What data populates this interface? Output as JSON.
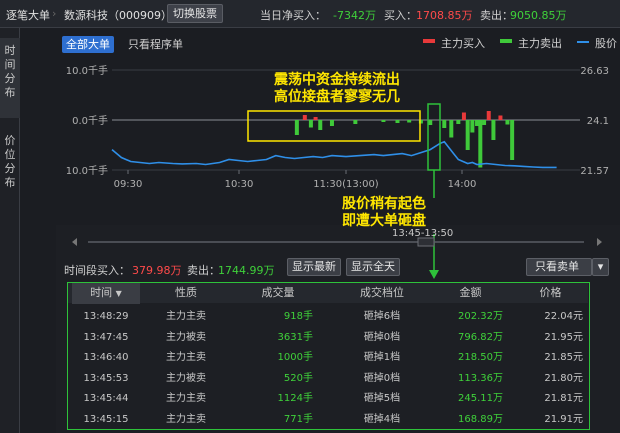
{
  "topbar": {
    "tab_label": "逐笔大单",
    "stock_name": "数源科技（000909）",
    "switch_label": "切换股票",
    "net_buy_label": "当日净买入：",
    "net_buy_value": "-7342万",
    "buy_label": "买入：",
    "buy_value": "1708.85万",
    "sell_label": "卖出：",
    "sell_value": "9050.85万"
  },
  "sidebar": {
    "tabs": [
      {
        "label": "时间分布"
      },
      {
        "label": "价位分布"
      }
    ]
  },
  "filters": {
    "all_label": "全部大单",
    "program_label": "只看程序单"
  },
  "legend": [
    {
      "name": "主力买入",
      "color": "#e8393a"
    },
    {
      "name": "主力卖出",
      "color": "#3fc93a"
    },
    {
      "name": "股价",
      "color": "#2f8fe8"
    }
  ],
  "chart_data": {
    "type": "bar",
    "left_ticks": [
      "10.0千手",
      "0.0千手",
      "10.0千手"
    ],
    "right_ticks": [
      "26.63",
      "24.1",
      "21.57"
    ],
    "x_ticks": [
      "09:30",
      "10:30",
      "11:30(13:00)",
      "14:00"
    ],
    "annotation1": "震荡中资金持续流出\n高位接盘者寥寥无几",
    "annotation2": "股价稍有起色\n即遭大单砸盘",
    "buy_series_name": "主力买入",
    "sell_series_name": "主力卖出",
    "price_series_name": "股价",
    "bars": [
      {
        "t": 0.395,
        "v": -3.0
      },
      {
        "t": 0.412,
        "v": 1.0
      },
      {
        "t": 0.425,
        "v": -1.5
      },
      {
        "t": 0.435,
        "v": 0.6
      },
      {
        "t": 0.445,
        "v": -2.0
      },
      {
        "t": 0.47,
        "v": -1.2
      },
      {
        "t": 0.52,
        "v": -0.8
      },
      {
        "t": 0.58,
        "v": -0.4
      },
      {
        "t": 0.61,
        "v": -0.6
      },
      {
        "t": 0.635,
        "v": -0.5
      },
      {
        "t": 0.66,
        "v": -0.7
      },
      {
        "t": 0.68,
        "v": -1.0
      },
      {
        "t": 0.71,
        "v": -1.6
      },
      {
        "t": 0.725,
        "v": -3.5
      },
      {
        "t": 0.74,
        "v": -0.8
      },
      {
        "t": 0.752,
        "v": 1.5
      },
      {
        "t": 0.76,
        "v": -6.0
      },
      {
        "t": 0.77,
        "v": -2.5
      },
      {
        "t": 0.78,
        "v": -1.2
      },
      {
        "t": 0.787,
        "v": -9.5
      },
      {
        "t": 0.795,
        "v": -1.0
      },
      {
        "t": 0.805,
        "v": 1.8
      },
      {
        "t": 0.815,
        "v": -4.0
      },
      {
        "t": 0.83,
        "v": 0.9
      },
      {
        "t": 0.845,
        "v": -0.9
      },
      {
        "t": 0.855,
        "v": -8.0
      }
    ],
    "price": [
      [
        0.0,
        22.6
      ],
      [
        0.02,
        22.2
      ],
      [
        0.04,
        22.0
      ],
      [
        0.06,
        21.95
      ],
      [
        0.08,
        21.9
      ],
      [
        0.1,
        21.95
      ],
      [
        0.13,
        21.9
      ],
      [
        0.15,
        21.88
      ],
      [
        0.18,
        21.9
      ],
      [
        0.2,
        21.85
      ],
      [
        0.23,
        21.95
      ],
      [
        0.25,
        22.1
      ],
      [
        0.27,
        22.05
      ],
      [
        0.29,
        22.0
      ],
      [
        0.31,
        22.05
      ],
      [
        0.33,
        22.1
      ],
      [
        0.35,
        22.3
      ],
      [
        0.37,
        22.2
      ],
      [
        0.39,
        22.15
      ],
      [
        0.41,
        22.2
      ],
      [
        0.43,
        22.25
      ],
      [
        0.45,
        22.2
      ],
      [
        0.47,
        22.3
      ],
      [
        0.5,
        22.25
      ],
      [
        0.53,
        22.3
      ],
      [
        0.56,
        22.35
      ],
      [
        0.58,
        22.3
      ],
      [
        0.6,
        22.35
      ],
      [
        0.62,
        22.4
      ],
      [
        0.64,
        22.3
      ],
      [
        0.66,
        22.45
      ],
      [
        0.68,
        22.6
      ],
      [
        0.7,
        22.9
      ],
      [
        0.71,
        23.0
      ],
      [
        0.72,
        22.7
      ],
      [
        0.73,
        22.4
      ],
      [
        0.74,
        22.1
      ],
      [
        0.75,
        22.0
      ],
      [
        0.76,
        21.9
      ],
      [
        0.77,
        21.95
      ],
      [
        0.78,
        21.85
      ],
      [
        0.8,
        21.9
      ],
      [
        0.82,
        21.85
      ],
      [
        0.84,
        21.8
      ],
      [
        0.86,
        21.78
      ],
      [
        0.88,
        21.75
      ],
      [
        0.9,
        21.72
      ],
      [
        0.92,
        21.7
      ],
      [
        0.95,
        21.7
      ]
    ]
  },
  "detail": {
    "time_range": "13:45-13:50",
    "buy_label": "时间段买入：",
    "buy_value": "379.98万",
    "sell_label": "卖出：",
    "sell_value": "1744.99万",
    "btn_latest": "显示最新",
    "btn_all": "显示全天",
    "filter_select": "只看卖单",
    "headers": [
      "时间",
      "性质",
      "成交量",
      "成交档位",
      "金额",
      "价格"
    ],
    "rows": [
      {
        "time": "13:48:29",
        "type": "主力主卖",
        "vol": "918手",
        "level": "砸掉6档",
        "amount": "202.32万",
        "price": "22.04元"
      },
      {
        "time": "13:47:45",
        "type": "主力被卖",
        "vol": "3631手",
        "level": "砸掉0档",
        "amount": "796.82万",
        "price": "21.95元"
      },
      {
        "time": "13:46:40",
        "type": "主力主卖",
        "vol": "1000手",
        "level": "砸掉1档",
        "amount": "218.50万",
        "price": "21.85元"
      },
      {
        "time": "13:45:53",
        "type": "主力被卖",
        "vol": "520手",
        "level": "砸掉0档",
        "amount": "113.36万",
        "price": "21.80元"
      },
      {
        "time": "13:45:44",
        "type": "主力主卖",
        "vol": "1124手",
        "level": "砸掉5档",
        "amount": "245.11万",
        "price": "21.81元"
      },
      {
        "time": "13:45:15",
        "type": "主力主卖",
        "vol": "771手",
        "level": "砸掉4档",
        "amount": "168.89万",
        "price": "21.91元"
      }
    ]
  }
}
